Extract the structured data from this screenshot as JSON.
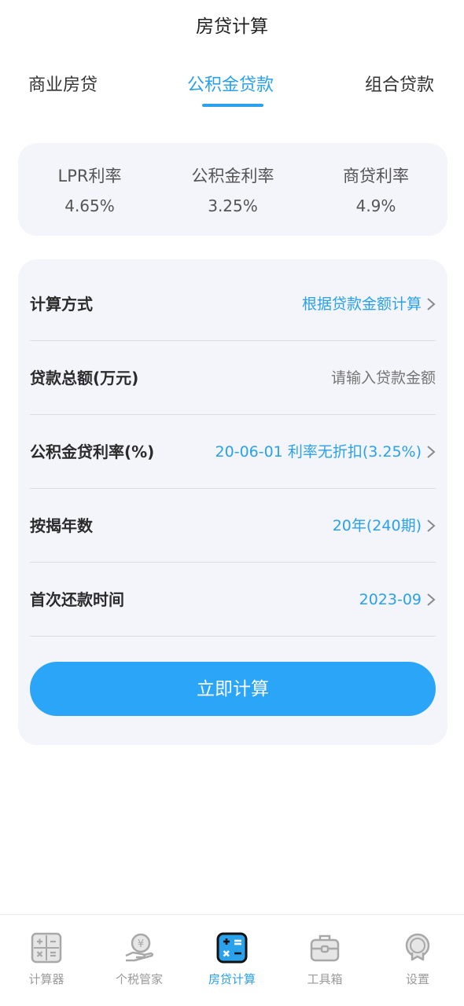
{
  "app_title": "房贷计算",
  "tabs": [
    {
      "label": "商业房贷",
      "active": false
    },
    {
      "label": "公积金贷款",
      "active": true
    },
    {
      "label": "组合贷款",
      "active": false
    }
  ],
  "rates": [
    {
      "label": "LPR利率",
      "value": "4.65%"
    },
    {
      "label": "公积金利率",
      "value": "3.25%"
    },
    {
      "label": "商贷利率",
      "value": "4.9%"
    }
  ],
  "form": {
    "calc_method": {
      "label": "计算方式",
      "value": "根据贷款金额计算"
    },
    "loan_amount": {
      "label": "贷款总额(万元)",
      "value": "",
      "placeholder": "请输入贷款金额"
    },
    "fund_rate": {
      "label": "公积金贷利率(%)",
      "value": "20-06-01 利率无折扣(3.25%)"
    },
    "years": {
      "label": "按揭年数",
      "value": "20年(240期)"
    },
    "first_payment": {
      "label": "首次还款时间",
      "value": "2023-09"
    },
    "submit_label": "立即计算"
  },
  "bottom_nav": [
    {
      "label": "计算器",
      "icon": "calculator-icon",
      "active": false
    },
    {
      "label": "个税管家",
      "icon": "tax-coin-hand-icon",
      "active": false
    },
    {
      "label": "房贷计算",
      "icon": "mortgage-calculator-icon",
      "active": true
    },
    {
      "label": "工具箱",
      "icon": "toolbox-icon",
      "active": false
    },
    {
      "label": "设置",
      "icon": "settings-icon",
      "active": false
    }
  ],
  "colors": {
    "accent": "#2aa1eb",
    "button": "#2aa5f8",
    "card_bg": "#f4f4fb",
    "text_dark": "#2b2b2b",
    "text_muted": "#9a9a9a"
  }
}
